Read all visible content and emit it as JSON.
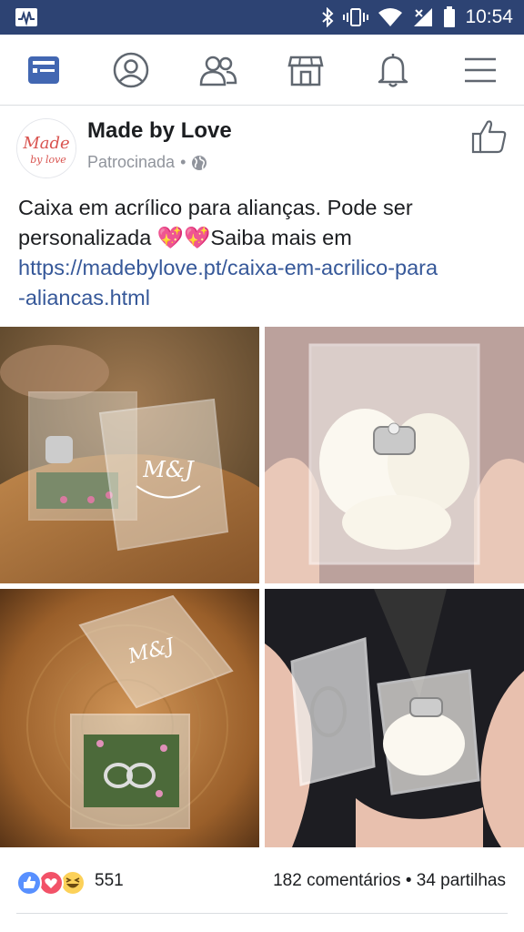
{
  "status_bar": {
    "time": "10:54",
    "icons": [
      "activity-icon",
      "bluetooth-icon",
      "vibrate-icon",
      "wifi-icon",
      "signal-icon",
      "battery-icon"
    ]
  },
  "nav": {
    "items": [
      "news-feed-icon",
      "profile-icon",
      "friends-icon",
      "marketplace-icon",
      "notifications-icon",
      "menu-icon"
    ],
    "active_color": "#4267b2",
    "inactive_color": "#606770"
  },
  "post": {
    "page_name": "Made by Love",
    "sponsored_label": "Patrocinada",
    "separator": "•",
    "avatar_text_top": "Made",
    "avatar_text_bottom": "by love",
    "text_line1": "Caixa em acrílico para alianças. Pode ser",
    "text_line2_pre": "personalizada ",
    "text_emoji": "💖💖",
    "text_line2_post": "Saiba mais em",
    "link_line1": "https://madebylove.pt/caixa-em-acrilico-para",
    "link_line2": "-aliancas.html",
    "photo_monogram": "M&J"
  },
  "engagement": {
    "reaction_count": "551",
    "comments_shares": "182 comentários • 34 partilhas",
    "reaction_icons": [
      "like-reaction-icon",
      "love-reaction-icon",
      "haha-reaction-icon"
    ]
  },
  "colors": {
    "status_bar": "#2d4373",
    "link": "#365899",
    "secondary_text": "#90949c"
  }
}
